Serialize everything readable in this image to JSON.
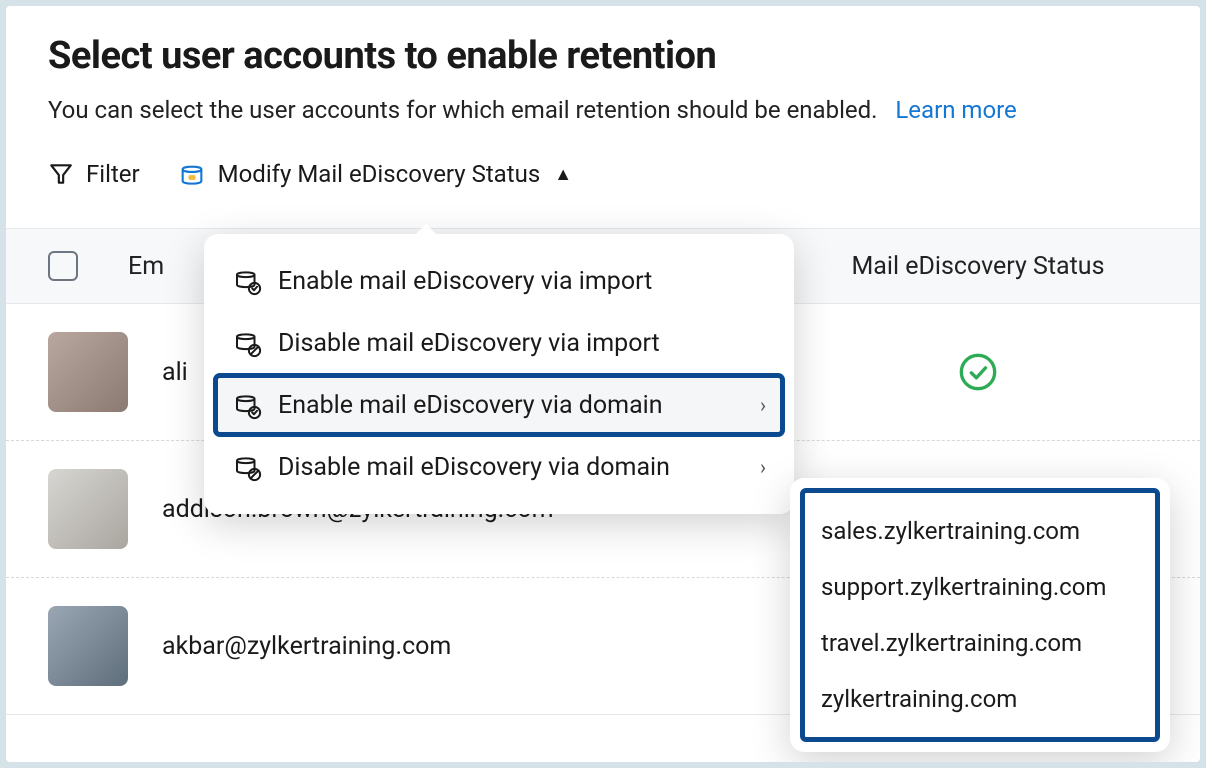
{
  "header": {
    "title": "Select user accounts to enable retention",
    "subtitle": "You can select the user accounts for which email retention should be enabled.",
    "learn_more": "Learn more"
  },
  "toolbar": {
    "filter_label": "Filter",
    "modify_label": "Modify Mail eDiscovery Status"
  },
  "dropdown": {
    "items": [
      {
        "label": "Enable mail eDiscovery via import",
        "has_sub": false
      },
      {
        "label": "Disable mail eDiscovery via import",
        "has_sub": false
      },
      {
        "label": "Enable mail eDiscovery via domain",
        "has_sub": true,
        "selected": true
      },
      {
        "label": "Disable mail eDiscovery via domain",
        "has_sub": true
      }
    ]
  },
  "submenu": {
    "domains": [
      "sales.zylkertraining.com",
      "support.zylkertraining.com",
      "travel.zylkertraining.com",
      "zylkertraining.com"
    ]
  },
  "table": {
    "columns": {
      "email": "Em",
      "status": "Mail eDiscovery Status"
    },
    "rows": [
      {
        "email": "ali",
        "status_enabled": true
      },
      {
        "email": "addison.brown@zylkertraining.com",
        "status_enabled": false
      },
      {
        "email": "akbar@zylkertraining.com",
        "status_enabled": false
      }
    ]
  }
}
